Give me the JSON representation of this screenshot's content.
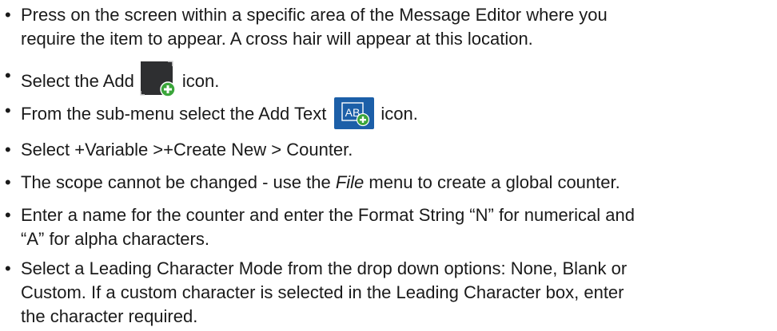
{
  "bullets": [
    {
      "line1": "Press on the screen within a specific area of the Message Editor where you",
      "line2": "require the item to appear. A cross hair will appear at this location."
    },
    {
      "before": "Select the Add",
      "icon": "add-icon",
      "after": "icon."
    },
    {
      "before": "From the sub-menu select the Add Text",
      "icon": "add-text-icon",
      "icon_text": "AB",
      "after": "icon."
    },
    {
      "line1": "Select +Variable >+Create New > Counter."
    },
    {
      "before": "The scope cannot be changed - use the ",
      "italic": "File",
      "after": " menu to create a global counter."
    },
    {
      "line1": "Enter a name for the counter and enter the Format String “N” for numerical and",
      "line2": "“A” for alpha characters."
    },
    {
      "line1": "Select a Leading Character Mode from the drop down options: None, Blank or",
      "line2": "Custom. If a custom character is selected in the Leading Character box, enter",
      "line3": "the character required."
    }
  ],
  "bullet_glyph": "•",
  "colors": {
    "text": "#1a1a1a",
    "add_icon_bg": "#2e2f31",
    "add_icon_badge": "#3aa53a",
    "addtext_icon_bg": "#1c5fa8"
  }
}
